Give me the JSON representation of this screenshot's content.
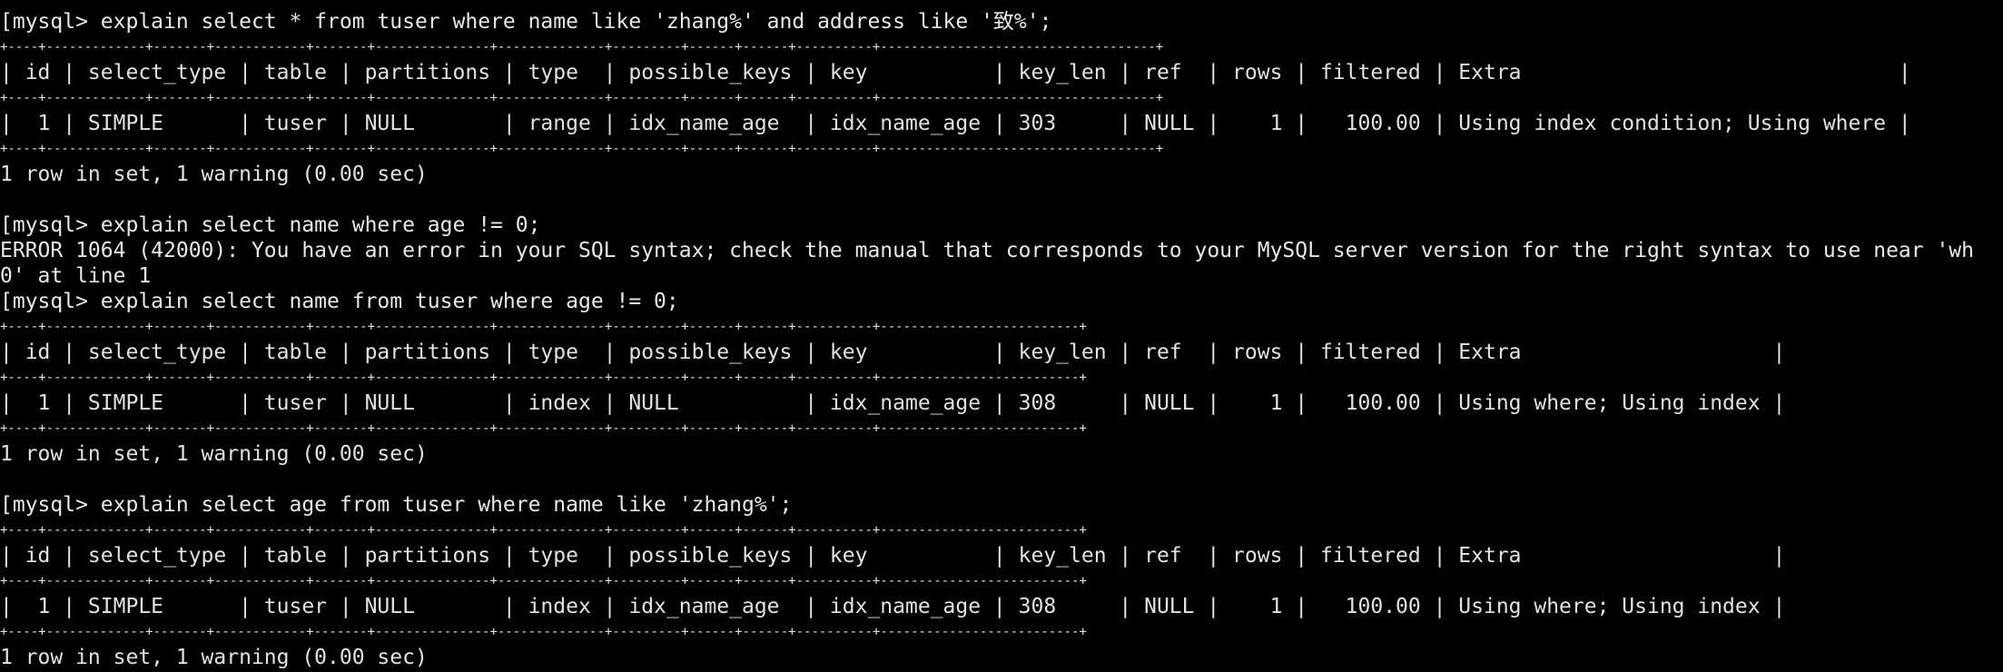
{
  "terminal": {
    "lines": [
      {
        "text": "[mysql> explain select * from tuser where name like 'zhang%' and address like '致%';"
      },
      {
        "text": "+----+-------------+-------+------------+-------+---------------+--------------+---------+------+------+----------+------------------------------------+"
      },
      {
        "text": "| id | select_type | table | partitions | type  | possible_keys | key          | key_len | ref  | rows | filtered | Extra                              |"
      },
      {
        "text": "+----+-------------+-------+------------+-------+---------------+--------------+---------+------+------+----------+------------------------------------+"
      },
      {
        "text": "|  1 | SIMPLE      | tuser | NULL       | range | idx_name_age  | idx_name_age | 303     | NULL |    1 |   100.00 | Using index condition; Using where |"
      },
      {
        "text": "+----+-------------+-------+------------+-------+---------------+--------------+---------+------+------+----------+------------------------------------+"
      },
      {
        "text": "1 row in set, 1 warning (0.00 sec)"
      },
      {
        "text": ""
      },
      {
        "text": "[mysql> explain select name where age != 0;"
      },
      {
        "text": "ERROR 1064 (42000): You have an error in your SQL syntax; check the manual that corresponds to your MySQL server version for the right syntax to use near 'wh"
      },
      {
        "text": "0' at line 1"
      },
      {
        "text": "[mysql> explain select name from tuser where age != 0;"
      },
      {
        "text": "+----+-------------+-------+------------+-------+---------------+--------------+---------+------+------+----------+--------------------------+"
      },
      {
        "text": "| id | select_type | table | partitions | type  | possible_keys | key          | key_len | ref  | rows | filtered | Extra                    |"
      },
      {
        "text": "+----+-------------+-------+------------+-------+---------------+--------------+---------+------+------+----------+--------------------------+"
      },
      {
        "text": "|  1 | SIMPLE      | tuser | NULL       | index | NULL          | idx_name_age | 308     | NULL |    1 |   100.00 | Using where; Using index |"
      },
      {
        "text": "+----+-------------+-------+------------+-------+---------------+--------------+---------+------+------+----------+--------------------------+"
      },
      {
        "text": "1 row in set, 1 warning (0.00 sec)"
      },
      {
        "text": ""
      },
      {
        "text": "[mysql> explain select age from tuser where name like 'zhang%';"
      },
      {
        "text": "+----+-------------+-------+------------+-------+---------------+--------------+---------+------+------+----------+--------------------------+"
      },
      {
        "text": "| id | select_type | table | partitions | type  | possible_keys | key          | key_len | ref  | rows | filtered | Extra                    |"
      },
      {
        "text": "+----+-------------+-------+------------+-------+---------------+--------------+---------+------+------+----------+--------------------------+"
      },
      {
        "text": "|  1 | SIMPLE      | tuser | NULL       | index | idx_name_age  | idx_name_age | 308     | NULL |    1 |   100.00 | Using where; Using index |"
      },
      {
        "text": "+----+-------------+-------+------------+-------+---------------+--------------+---------+------+------+----------+--------------------------+"
      },
      {
        "text": "1 row in set, 1 warning (0.00 sec)"
      }
    ]
  }
}
